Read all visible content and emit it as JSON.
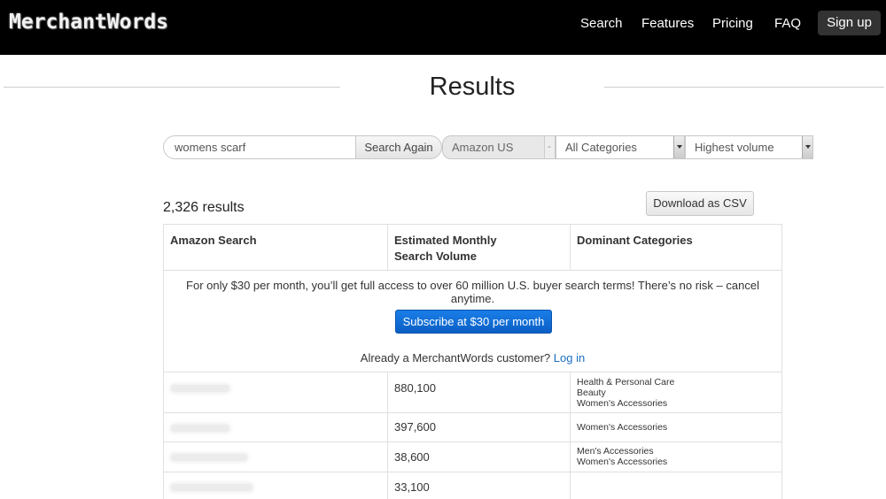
{
  "header": {
    "logo": "MerchantWords",
    "nav": [
      "Search",
      "Features",
      "Pricing",
      "FAQ"
    ],
    "signup": "Sign up"
  },
  "page_title": "Results",
  "search": {
    "value": "womens scarf",
    "button": "Search Again",
    "marketplace": "Amazon US",
    "category": "All Categories",
    "sort": "Highest volume"
  },
  "results": {
    "count": "2,326 results",
    "download": "Download as CSV"
  },
  "table": {
    "headers": [
      "Amazon Search",
      "Estimated Monthly Search Volume",
      "Dominant Categories"
    ],
    "promo": {
      "text": "For only $30 per month, you’ll get full access to over 60 million U.S. buyer search terms! There’s no risk – cancel anytime.",
      "button": "Subscribe at $30 per month",
      "login_prefix": "Already a MerchantWords customer?",
      "login_link": "Log in"
    },
    "rows": [
      {
        "volume": "880,100",
        "categories": [
          "Health & Personal Care",
          "Beauty",
          "Women's Accessories"
        ]
      },
      {
        "volume": "397,600",
        "categories": [
          "Women's Accessories"
        ]
      },
      {
        "volume": "38,600",
        "categories": [
          "Men's Accessories",
          "Women's Accessories"
        ]
      },
      {
        "volume": "33,100",
        "categories": []
      }
    ]
  }
}
